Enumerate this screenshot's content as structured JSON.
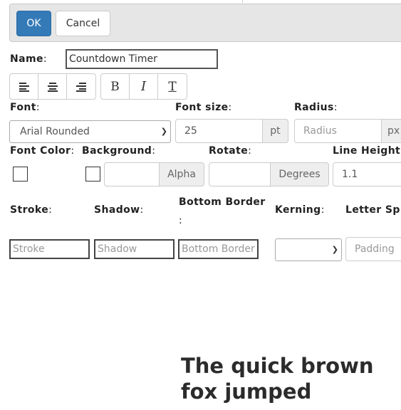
{
  "toolbar": {
    "ok_label": "OK",
    "cancel_label": "Cancel"
  },
  "name": {
    "label": "Name",
    "value": "Countdown Timer"
  },
  "format_buttons": {
    "align_left": "align-left-icon",
    "align_center": "align-center-icon",
    "align_right": "align-right-icon",
    "bold": "B",
    "italic": "I",
    "clear_format": "T"
  },
  "font": {
    "label": "Font",
    "selected": "Arial Rounded"
  },
  "font_size": {
    "label": "Font size",
    "value": "25",
    "unit": "pt"
  },
  "radius": {
    "label": "Radius",
    "placeholder": "Radius",
    "unit": "px"
  },
  "font_color": {
    "label": "Font Color"
  },
  "background": {
    "label": "Background",
    "addon": "Alpha"
  },
  "rotate": {
    "label": "Rotate",
    "addon": "Degrees"
  },
  "line_height": {
    "label": "Line Height",
    "value": "1.1"
  },
  "stroke": {
    "label": "Stroke",
    "placeholder": "Stroke"
  },
  "shadow": {
    "label": "Shadow",
    "placeholder": "Shadow"
  },
  "bottom_border": {
    "label": "Bottom Border",
    "colon": ":",
    "placeholder": "Bottom Border"
  },
  "kerning": {
    "label": "Kerning",
    "selected": ""
  },
  "letter_spacing": {
    "label": "Letter Sp",
    "placeholder": "Padding"
  },
  "preview": {
    "line1": "The quick brown",
    "line2": "fox jumped"
  }
}
